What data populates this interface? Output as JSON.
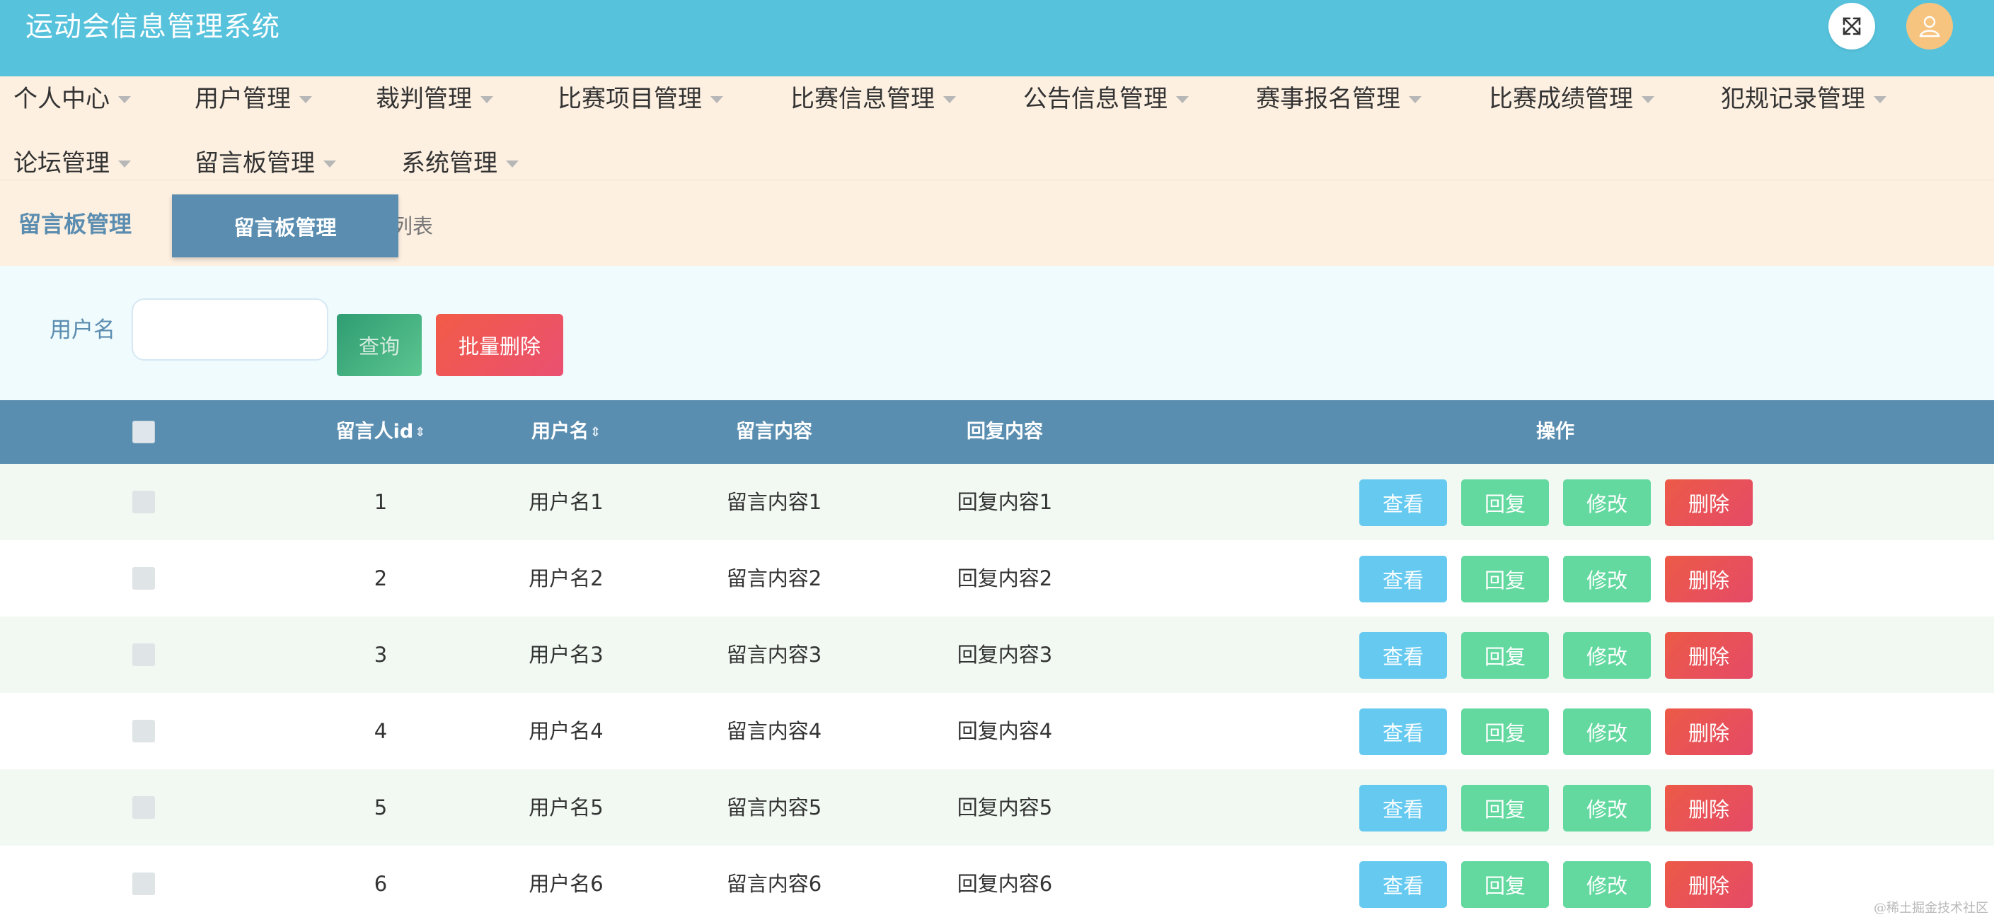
{
  "header": {
    "title": "运动会信息管理系统"
  },
  "nav": {
    "items": [
      {
        "label": "个人中心"
      },
      {
        "label": "用户管理"
      },
      {
        "label": "裁判管理"
      },
      {
        "label": "比赛项目管理"
      },
      {
        "label": "比赛信息管理"
      },
      {
        "label": "公告信息管理"
      },
      {
        "label": "赛事报名管理"
      },
      {
        "label": "比赛成绩管理"
      },
      {
        "label": "犯规记录管理"
      },
      {
        "label": "论坛管理"
      },
      {
        "label": "留言板管理"
      },
      {
        "label": "系统管理"
      }
    ]
  },
  "breadcrumb": {
    "main": "留言板管理",
    "sub": "板列表",
    "popup": "留言板管理"
  },
  "search": {
    "label": "用户名",
    "value": "",
    "placeholder": "",
    "query_label": "查询",
    "batch_delete_label": "批量删除"
  },
  "table": {
    "columns": {
      "id": "留言人id",
      "username": "用户名",
      "content": "留言内容",
      "reply": "回复内容",
      "ops": "操作"
    },
    "sort_glyph": "⇕",
    "buttons": {
      "view": "查看",
      "reply": "回复",
      "edit": "修改",
      "delete": "删除"
    },
    "rows": [
      {
        "id": "1",
        "username": "用户名1",
        "content": "留言内容1",
        "reply": "回复内容1"
      },
      {
        "id": "2",
        "username": "用户名2",
        "content": "留言内容2",
        "reply": "回复内容2"
      },
      {
        "id": "3",
        "username": "用户名3",
        "content": "留言内容3",
        "reply": "回复内容3"
      },
      {
        "id": "4",
        "username": "用户名4",
        "content": "留言内容4",
        "reply": "回复内容4"
      },
      {
        "id": "5",
        "username": "用户名5",
        "content": "留言内容5",
        "reply": "回复内容5"
      },
      {
        "id": "6",
        "username": "用户名6",
        "content": "留言内容6",
        "reply": "回复内容6"
      }
    ]
  },
  "watermark": "@稀土掘金技术社区",
  "colors": {
    "header": "#57c2dc",
    "nav_bg": "#fdf0e1",
    "table_header": "#5a8eb0",
    "view_btn": "#66caf0",
    "reply_btn": "#63d9a0",
    "edit_btn": "#63d9a0",
    "delete_btn": "#e9534f"
  }
}
